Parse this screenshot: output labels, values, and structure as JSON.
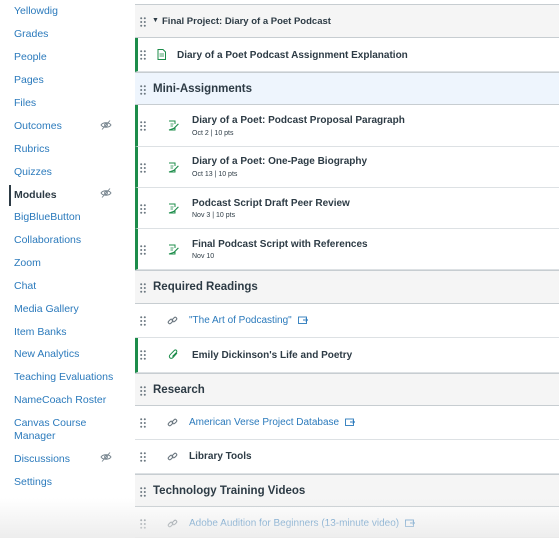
{
  "colors": {
    "link": "#2b7abc",
    "text": "#2d3b45",
    "published": "#1c8c4a",
    "header_bg": "#f5f5f5",
    "selected_header_bg": "#eef5fd"
  },
  "sidebar": {
    "items": [
      {
        "label": "Yellowdig"
      },
      {
        "label": "Grades"
      },
      {
        "label": "People"
      },
      {
        "label": "Pages"
      },
      {
        "label": "Files"
      },
      {
        "label": "Outcomes",
        "hidden_icon": "eye-slash-icon"
      },
      {
        "label": "Rubrics"
      },
      {
        "label": "Quizzes"
      },
      {
        "label": "Modules",
        "active": true,
        "hidden_icon": "eye-slash-icon"
      },
      {
        "label": "BigBlueButton"
      },
      {
        "label": "Collaborations"
      },
      {
        "label": "Zoom"
      },
      {
        "label": "Chat"
      },
      {
        "label": "Media Gallery"
      },
      {
        "label": "Item Banks"
      },
      {
        "label": "New Analytics"
      },
      {
        "label": "Teaching Evaluations"
      },
      {
        "label": "NameCoach Roster"
      },
      {
        "label": "Canvas Course Manager"
      },
      {
        "label": "Discussions",
        "hidden_icon": "eye-slash-icon"
      },
      {
        "label": "Settings"
      }
    ]
  },
  "module": {
    "title": "Final Project: Diary of a Poet Podcast",
    "rows": [
      {
        "kind": "item",
        "title": "Diary of a Poet Podcast Assignment Explanation",
        "icon": "page-icon",
        "published": true
      },
      {
        "kind": "header",
        "title": "Mini-Assignments",
        "selected": true
      },
      {
        "kind": "item",
        "title": "Diary of a Poet: Podcast Proposal Paragraph",
        "icon": "assignment-icon",
        "published": true,
        "meta": "Oct 2  |  10 pts"
      },
      {
        "kind": "item",
        "title": "Diary of a Poet: One-Page Biography",
        "icon": "assignment-icon",
        "published": true,
        "meta": "Oct 13  |  10 pts"
      },
      {
        "kind": "item",
        "title": "Podcast Script Draft Peer Review",
        "icon": "assignment-icon",
        "published": true,
        "meta": "Nov 3  |  10 pts"
      },
      {
        "kind": "item",
        "title": "Final Podcast Script with References",
        "icon": "assignment-icon",
        "published": true,
        "meta": "Nov 10"
      },
      {
        "kind": "header",
        "title": "Required Readings"
      },
      {
        "kind": "item",
        "title": "\"The Art of Podcasting\"",
        "icon": "link-icon",
        "link": true,
        "external": true
      },
      {
        "kind": "item",
        "title": "Emily Dickinson's Life and Poetry",
        "icon": "attachment-icon",
        "published": true
      },
      {
        "kind": "header",
        "title": "Research"
      },
      {
        "kind": "item",
        "title": "American Verse Project Database",
        "icon": "link-icon",
        "link": true,
        "external": true
      },
      {
        "kind": "item",
        "title": "Library Tools",
        "icon": "link-icon"
      },
      {
        "kind": "header",
        "title": "Technology Training Videos"
      },
      {
        "kind": "item",
        "title": "Adobe Audition for Beginners (13-minute video)",
        "icon": "link-icon",
        "link": true,
        "external": true
      }
    ]
  }
}
